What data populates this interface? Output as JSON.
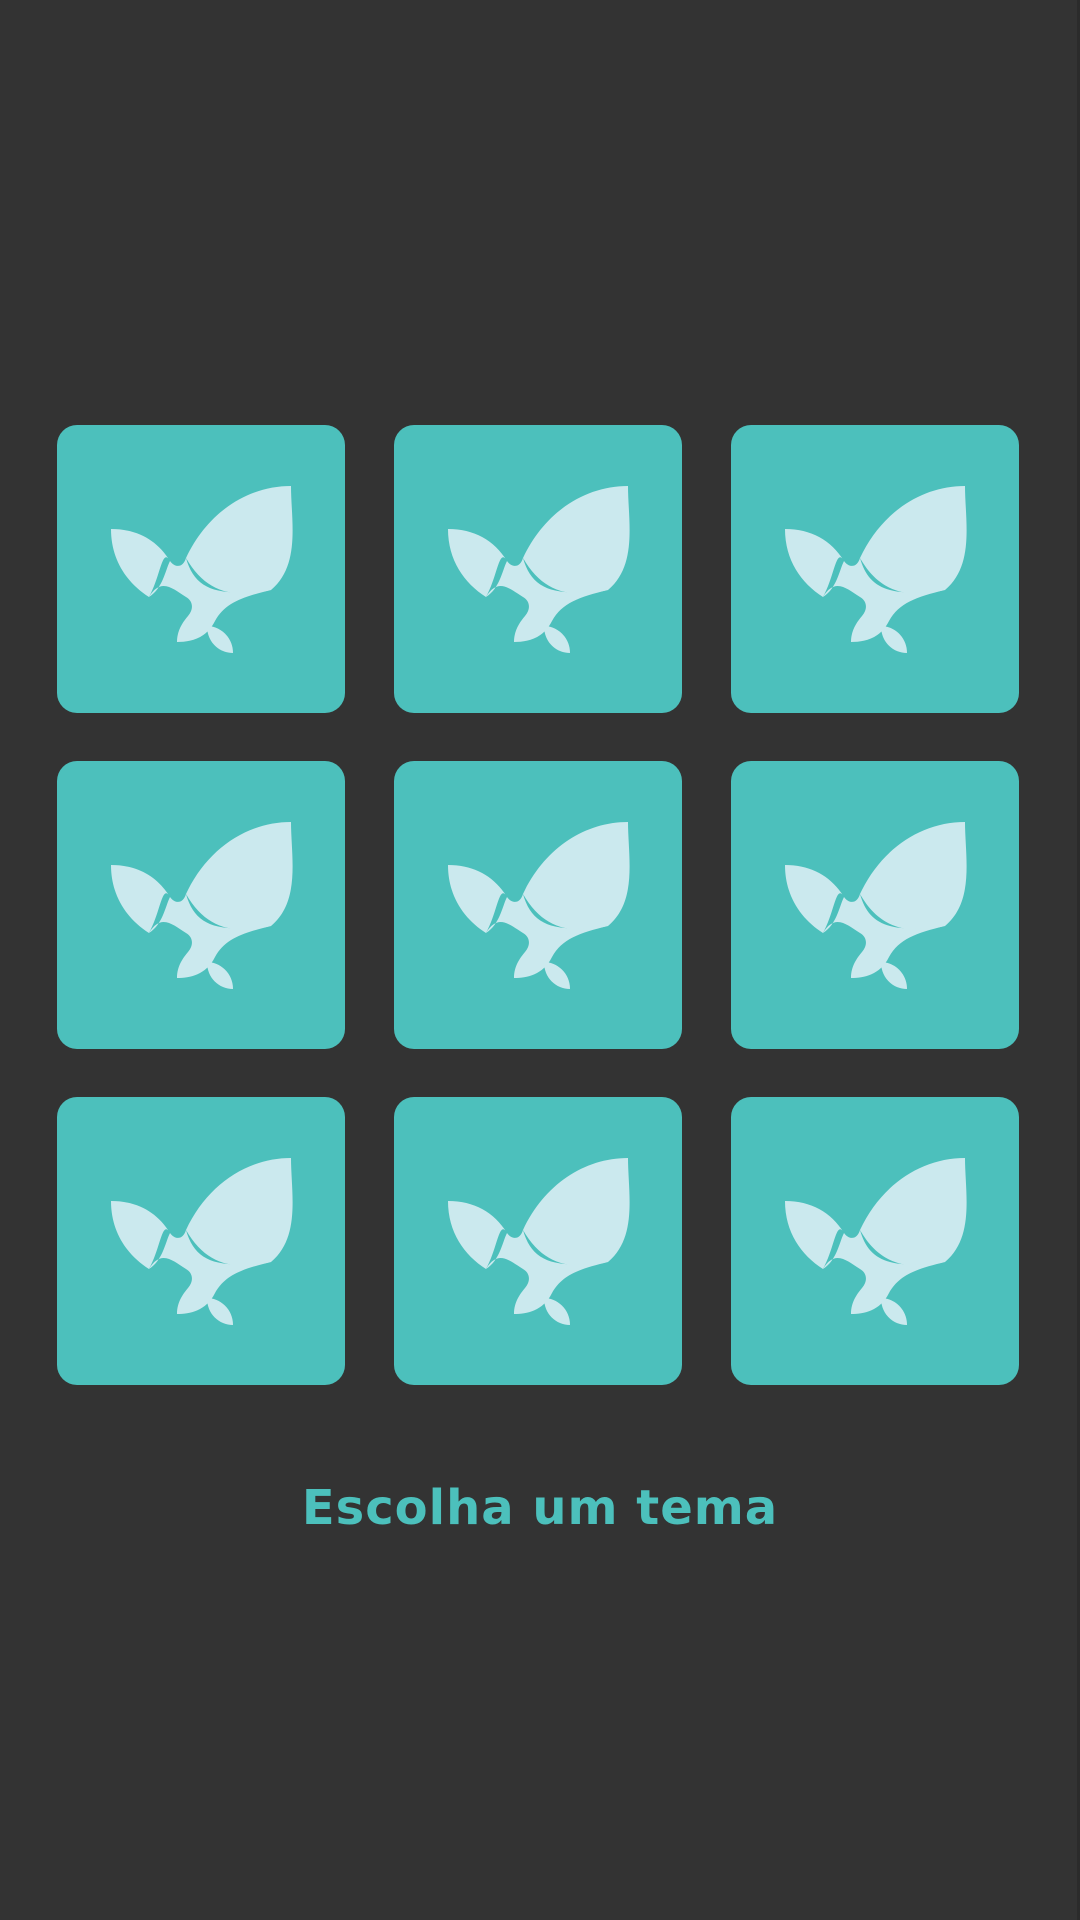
{
  "colors": {
    "background": "#333333",
    "card": "#4cc0bc",
    "icon": "#cbe9ee",
    "accent_text": "#4cc0bc"
  },
  "cards": [
    {
      "state": "face-down",
      "icon": "sprout-logo-icon"
    },
    {
      "state": "face-down",
      "icon": "sprout-logo-icon"
    },
    {
      "state": "face-down",
      "icon": "sprout-logo-icon"
    },
    {
      "state": "face-down",
      "icon": "sprout-logo-icon"
    },
    {
      "state": "face-down",
      "icon": "sprout-logo-icon"
    },
    {
      "state": "face-down",
      "icon": "sprout-logo-icon"
    },
    {
      "state": "face-down",
      "icon": "sprout-logo-icon"
    },
    {
      "state": "face-down",
      "icon": "sprout-logo-icon"
    },
    {
      "state": "face-down",
      "icon": "sprout-logo-icon"
    }
  ],
  "title": "Escolha um tema"
}
